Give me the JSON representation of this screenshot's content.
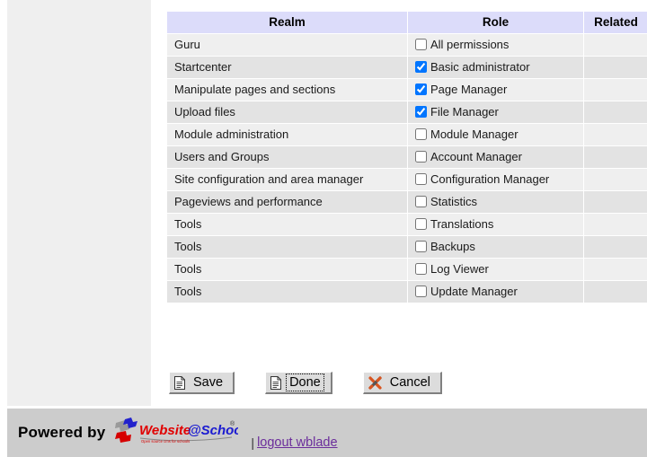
{
  "table": {
    "columns": [
      "Realm",
      "Role",
      "Related"
    ],
    "rows": [
      {
        "realm": "Guru",
        "role": "All permissions",
        "checked": false,
        "related": ""
      },
      {
        "realm": "Startcenter",
        "role": "Basic administrator",
        "checked": true,
        "related": ""
      },
      {
        "realm": "Manipulate pages and sections",
        "role": "Page Manager",
        "checked": true,
        "related": ""
      },
      {
        "realm": "Upload files",
        "role": "File Manager",
        "checked": true,
        "related": ""
      },
      {
        "realm": "Module administration",
        "role": "Module Manager",
        "checked": false,
        "related": ""
      },
      {
        "realm": "Users and Groups",
        "role": "Account Manager",
        "checked": false,
        "related": ""
      },
      {
        "realm": "Site configuration and area manager",
        "role": "Configuration Manager",
        "checked": false,
        "related": ""
      },
      {
        "realm": "Pageviews and performance",
        "role": "Statistics",
        "checked": false,
        "related": ""
      },
      {
        "realm": "Tools",
        "role": "Translations",
        "checked": false,
        "related": ""
      },
      {
        "realm": "Tools",
        "role": "Backups",
        "checked": false,
        "related": ""
      },
      {
        "realm": "Tools",
        "role": "Log Viewer",
        "checked": false,
        "related": ""
      },
      {
        "realm": "Tools",
        "role": "Update Manager",
        "checked": false,
        "related": ""
      }
    ]
  },
  "buttons": [
    {
      "label": "Save",
      "icon": "document-icon",
      "focused": false
    },
    {
      "label": "Done",
      "icon": "document-icon",
      "focused": true
    },
    {
      "label": "Cancel",
      "icon": "cancel-x-icon",
      "focused": false
    }
  ],
  "footer": {
    "powered_by": "Powered by",
    "logo": {
      "name_part1": "Website",
      "name_part2": "@School",
      "registered": "®",
      "tagline": "Open source cms for schools"
    },
    "separator": "|",
    "logout_label": "logout wblade"
  },
  "colors": {
    "header_bg": "#dcdcfa",
    "row_odd": "#efefef",
    "row_even": "#e3e3e3",
    "footer_bg": "#cccccc",
    "link": "#6b2d9b",
    "logo_red": "#e10000",
    "logo_blue": "#1a1ad1",
    "button_face": "#dcdcdc"
  }
}
